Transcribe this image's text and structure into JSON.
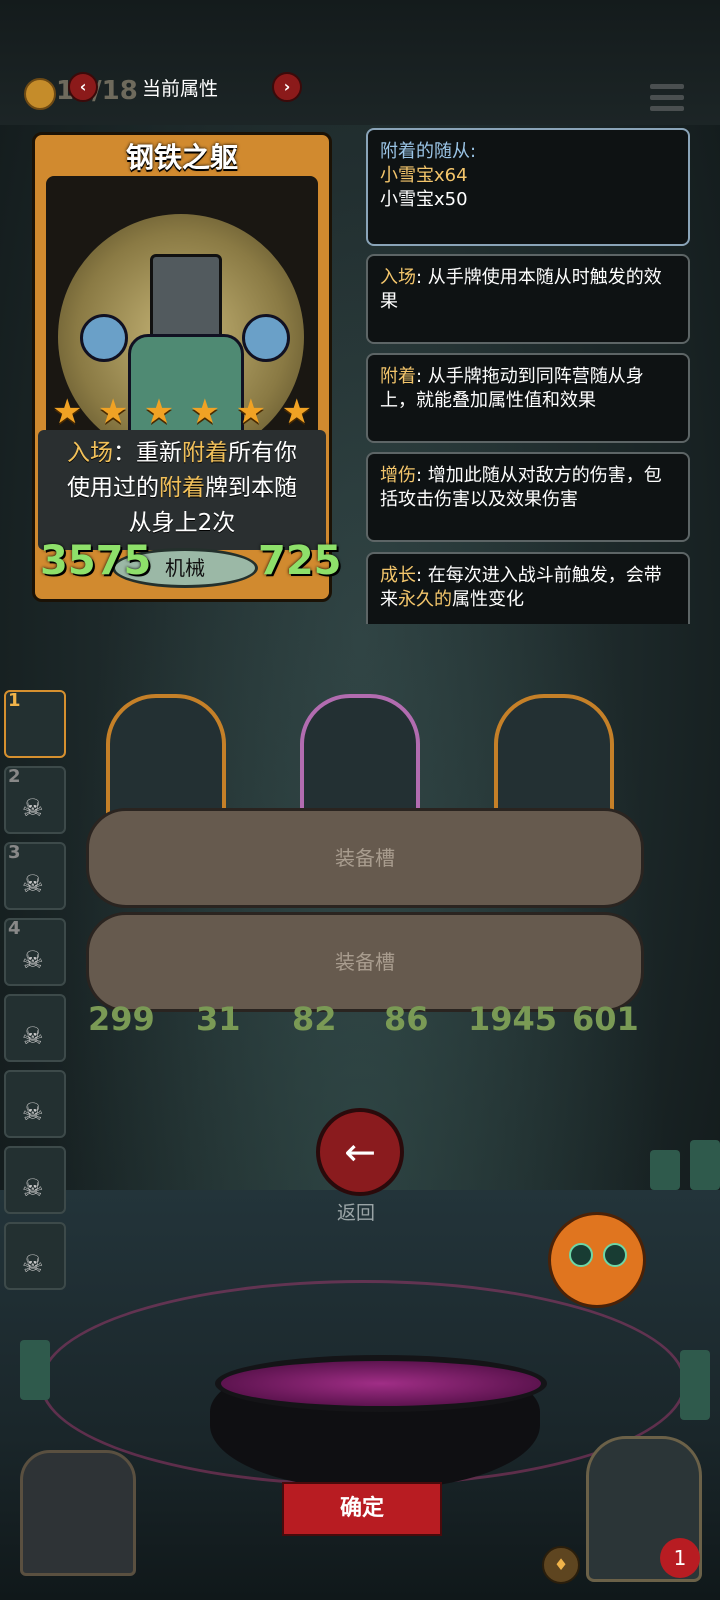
{
  "top_bar": {
    "coins": "18/18",
    "title": "当前属性",
    "prev_icon": "chevron-left-icon",
    "next_icon": "chevron-right-icon",
    "menu_icon": "menu-icon"
  },
  "card": {
    "name": "钢铁之躯",
    "stars": 6,
    "desc_prefix": "入场",
    "desc_line1_a": "：重新",
    "desc_line1_hl": "附着",
    "desc_line1_b": "所有你",
    "desc_line2_a": "使用过的",
    "desc_line2_hl": "附着",
    "desc_line2_b": "牌到本随",
    "desc_line3": "从身上2次",
    "attack": "3575",
    "health": "725",
    "tribe": "机械"
  },
  "attached": {
    "label": "附着的随从:",
    "items": [
      "小雪宝x64",
      "小雪宝x50"
    ]
  },
  "keywords": [
    {
      "name": "入场",
      "text": ": 从手牌使用本随从时触发的效果"
    },
    {
      "name": "附着",
      "text": ": 从手牌拖动到同阵营随从身上，就能叠加属性值和效果"
    },
    {
      "name": "增伤",
      "text": ": 增加此随从对敌方的伤害，包括攻击伤害以及效果伤害"
    },
    {
      "name": "成长",
      "text_a": ": 在每次进入战斗前触发，会带来",
      "text_hl": "永久的",
      "text_b": "属性变化"
    }
  ],
  "roster": {
    "slots": [
      "1",
      "2",
      "3",
      "4",
      "",
      "",
      "",
      ""
    ]
  },
  "board": {
    "minion1": {
      "attack": "299",
      "health": "31"
    },
    "minion2": {
      "attack": "82",
      "health": "86"
    },
    "minion3": {
      "attack": "1945",
      "health": "601"
    }
  },
  "equip_slots": [
    "装备槽",
    "装备槽"
  ],
  "back_label": "返回",
  "confirm_label": "确定",
  "hero_badge": "1"
}
